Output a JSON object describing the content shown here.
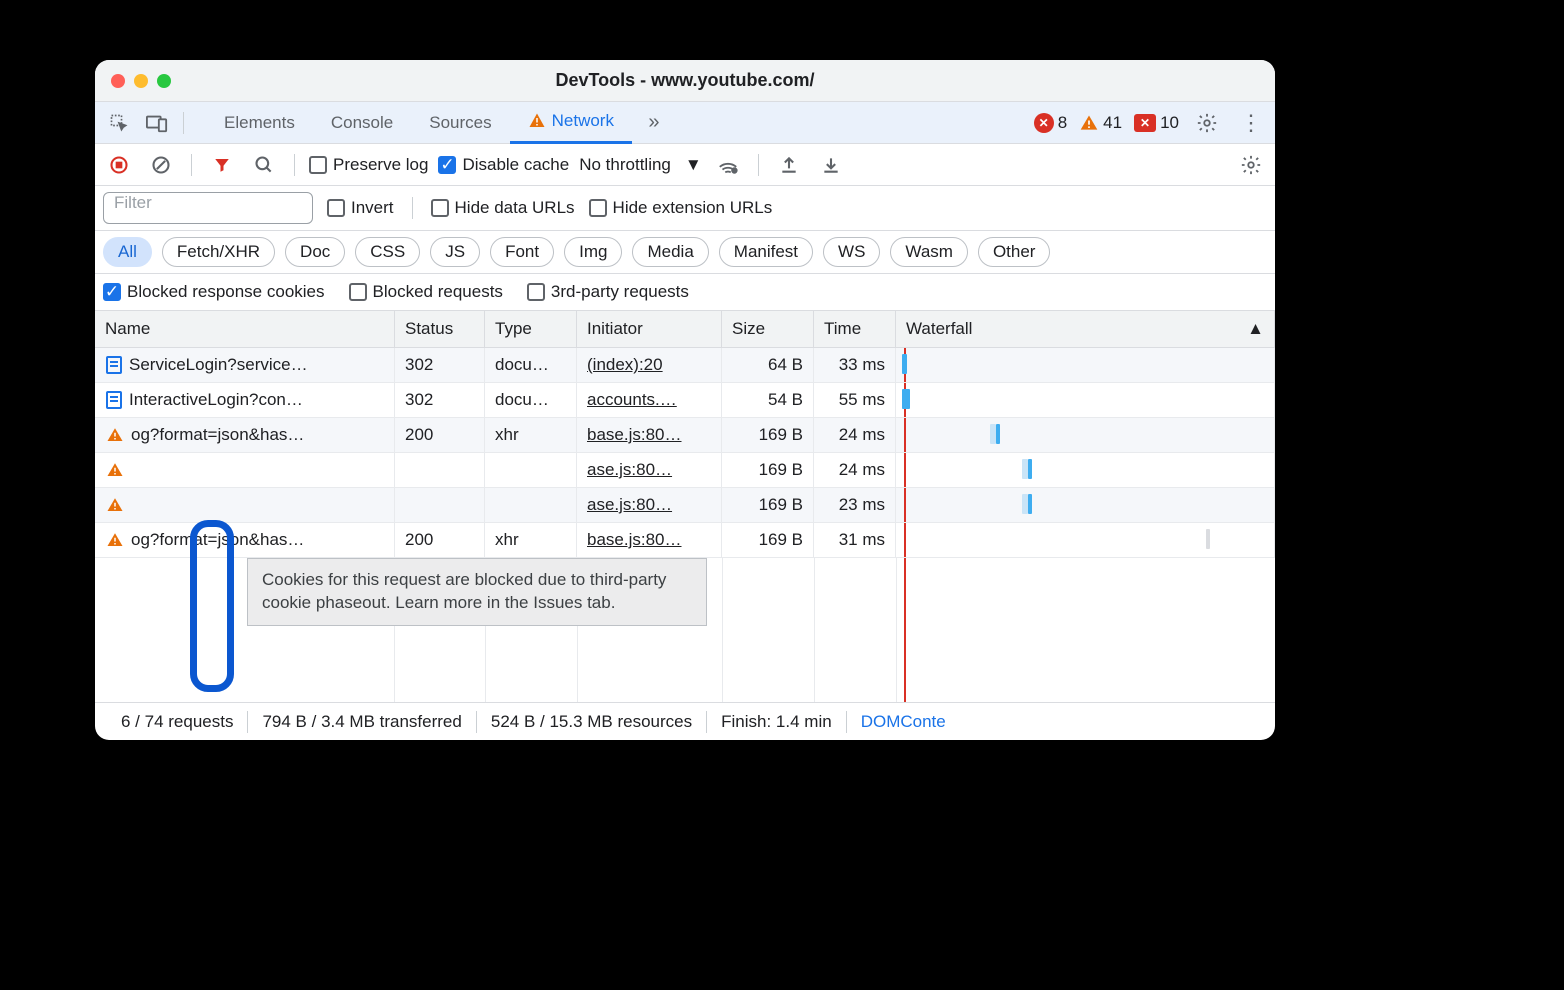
{
  "window": {
    "title": "DevTools - www.youtube.com/"
  },
  "tabs": {
    "items": [
      "Elements",
      "Console",
      "Sources",
      "Network"
    ],
    "active": "Network"
  },
  "counts": {
    "errors": "8",
    "warnings": "41",
    "messages": "10"
  },
  "toolbar": {
    "preserve_log": "Preserve log",
    "disable_cache": "Disable cache",
    "throttling": "No throttling"
  },
  "filterbar": {
    "filter_placeholder": "Filter",
    "invert": "Invert",
    "hide_data": "Hide data URLs",
    "hide_ext": "Hide extension URLs"
  },
  "pills": [
    "All",
    "Fetch/XHR",
    "Doc",
    "CSS",
    "JS",
    "Font",
    "Img",
    "Media",
    "Manifest",
    "WS",
    "Wasm",
    "Other"
  ],
  "checks": {
    "blocked_cookies": "Blocked response cookies",
    "blocked_requests": "Blocked requests",
    "third_party": "3rd-party requests"
  },
  "columns": {
    "name": "Name",
    "status": "Status",
    "type": "Type",
    "initiator": "Initiator",
    "size": "Size",
    "time": "Time",
    "waterfall": "Waterfall"
  },
  "rows": [
    {
      "icon": "doc",
      "name": "ServiceLogin?service…",
      "status": "302",
      "type": "docu…",
      "initiator": "(index):20",
      "size": "64 B",
      "time": "33 ms"
    },
    {
      "icon": "doc",
      "name": "InteractiveLogin?con…",
      "status": "302",
      "type": "docu…",
      "initiator": "accounts.…",
      "size": "54 B",
      "time": "55 ms"
    },
    {
      "icon": "warn",
      "name": "og?format=json&has…",
      "status": "200",
      "type": "xhr",
      "initiator": "base.js:80…",
      "size": "169 B",
      "time": "24 ms"
    },
    {
      "icon": "warn",
      "name": "",
      "status": "",
      "type": "",
      "initiator": "ase.js:80…",
      "size": "169 B",
      "time": "24 ms"
    },
    {
      "icon": "warn",
      "name": "",
      "status": "",
      "type": "",
      "initiator": "ase.js:80…",
      "size": "169 B",
      "time": "23 ms"
    },
    {
      "icon": "warn",
      "name": "og?format=json&has…",
      "status": "200",
      "type": "xhr",
      "initiator": "base.js:80…",
      "size": "169 B",
      "time": "31 ms"
    }
  ],
  "tooltip": "Cookies for this request are blocked due to third-party cookie phaseout. Learn more in the Issues tab.",
  "status": {
    "requests": "6 / 74 requests",
    "transferred": "794 B / 3.4 MB transferred",
    "resources": "524 B / 15.3 MB resources",
    "finish": "Finish: 1.4 min",
    "dom": "DOMConte"
  }
}
